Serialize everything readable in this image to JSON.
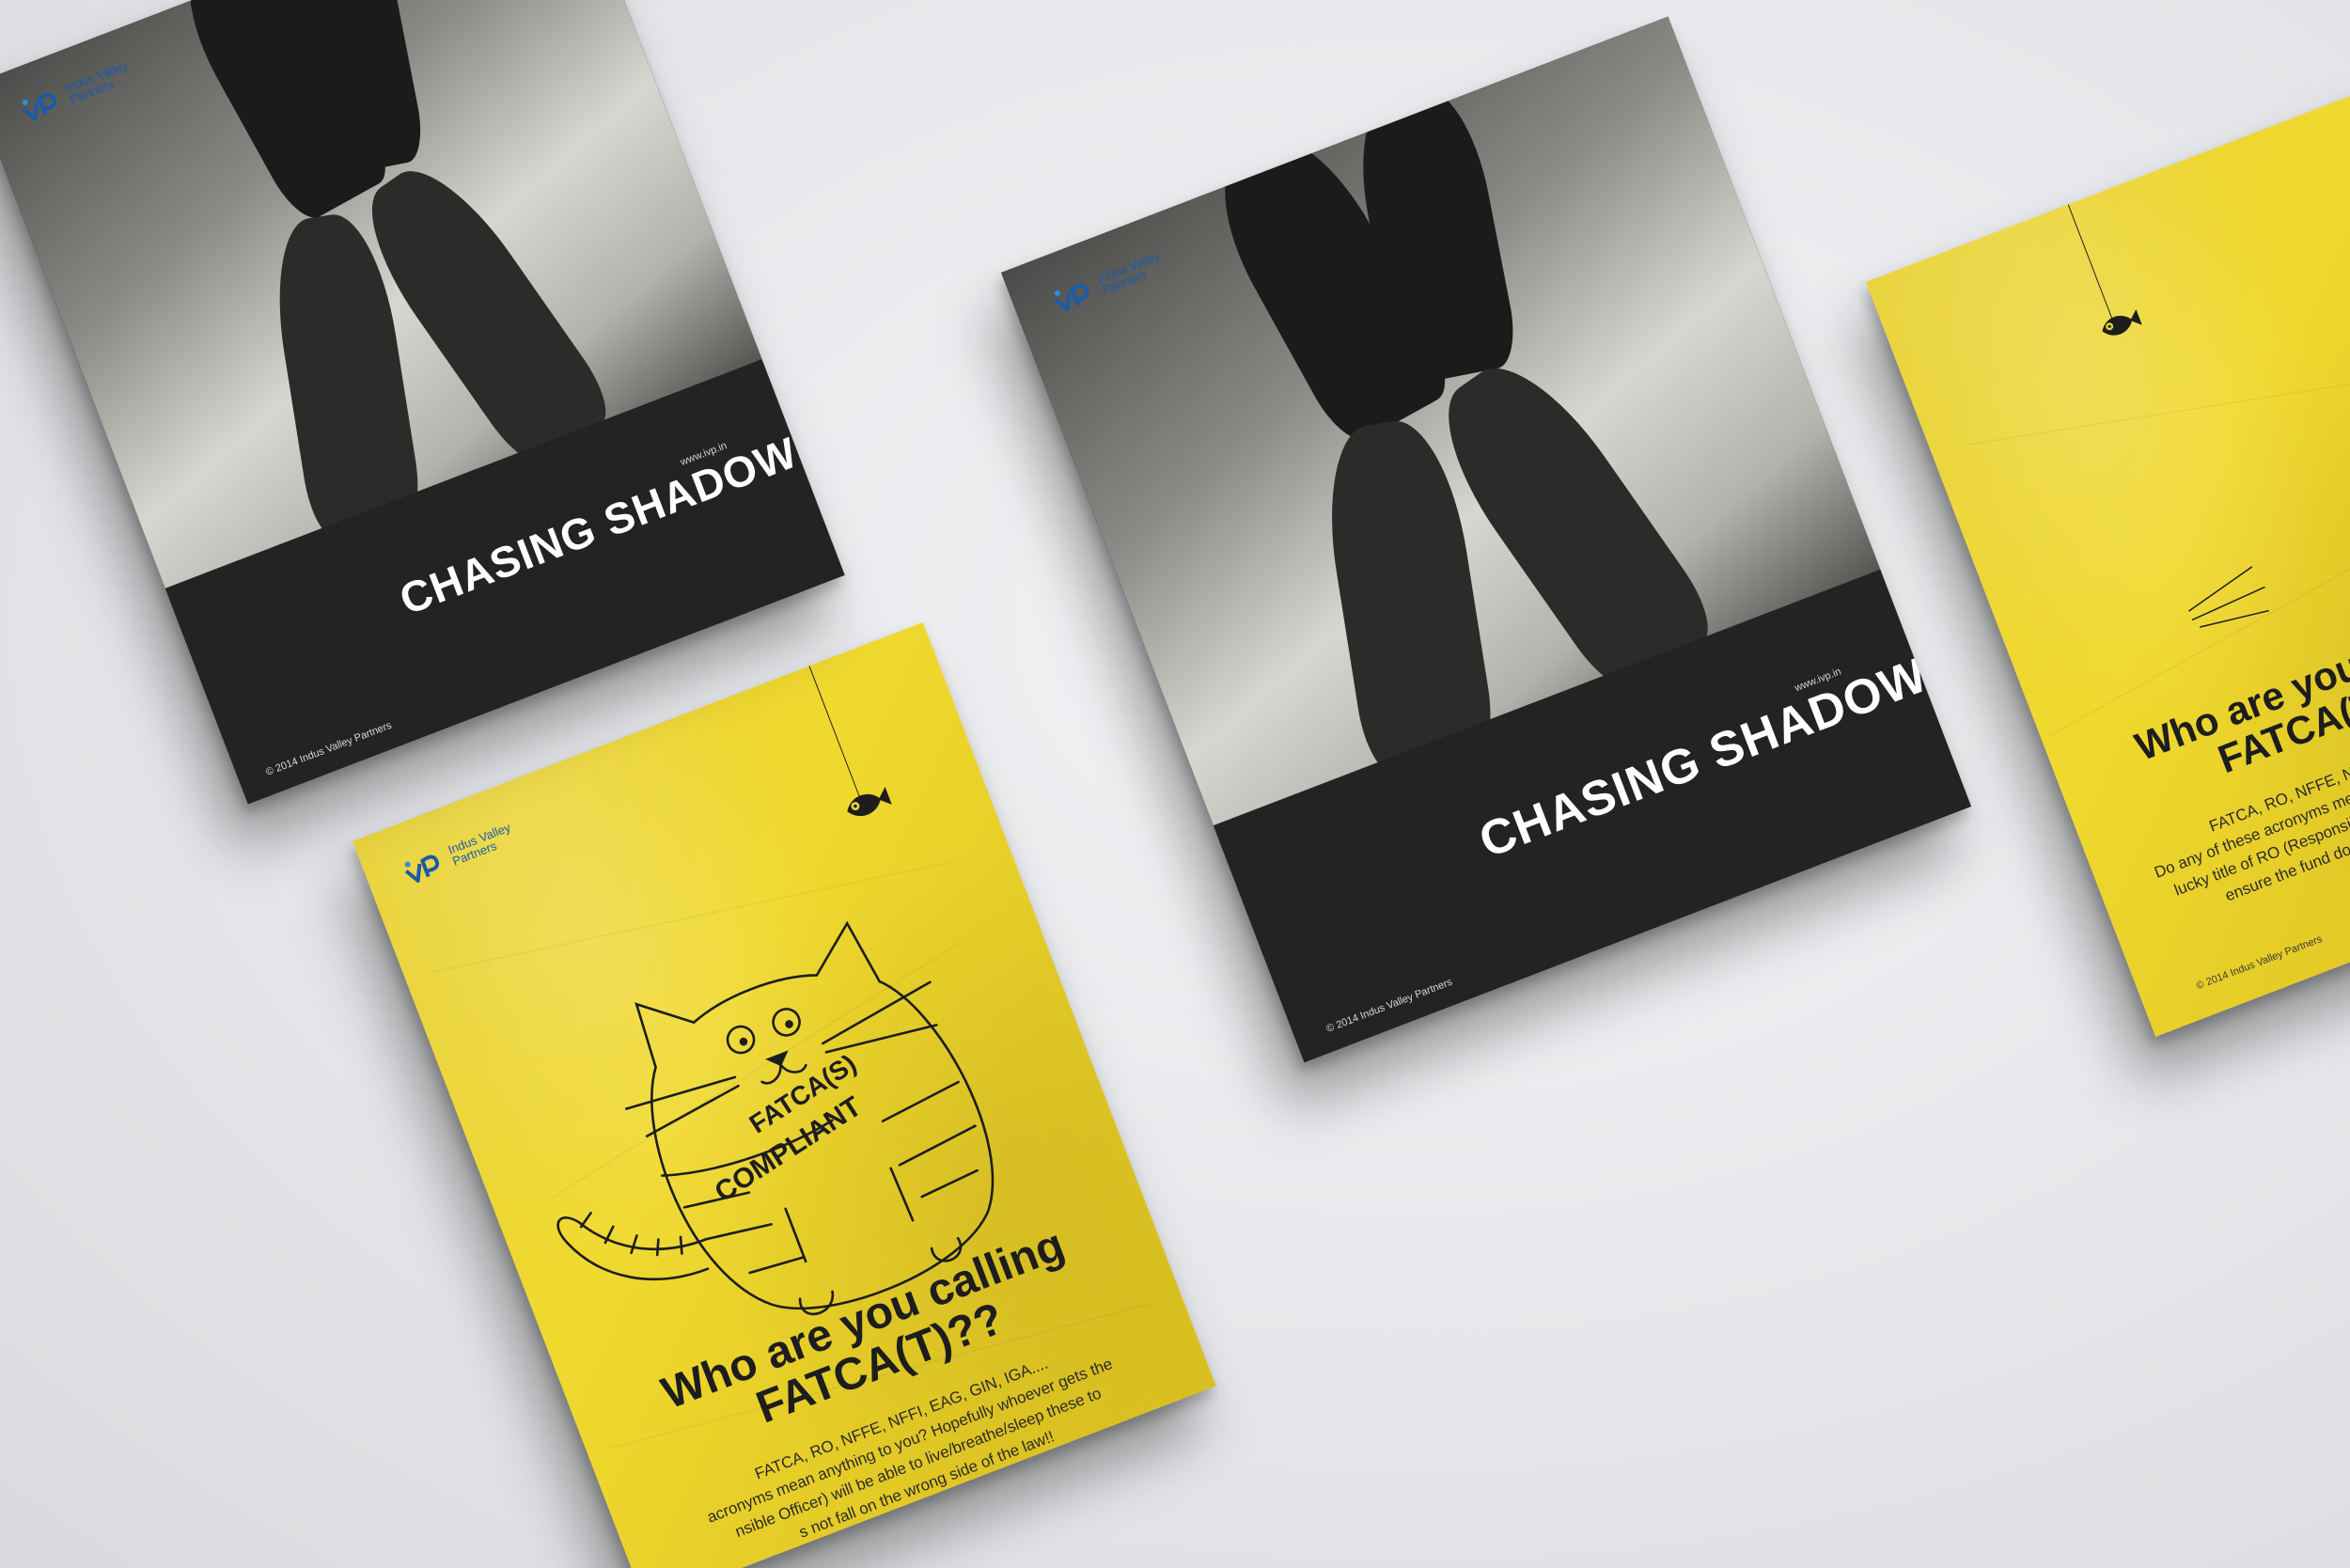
{
  "brand": {
    "logo_text_line1": "Indus Valley",
    "logo_text_line2": "Partners",
    "website": "www.ivp.in",
    "copyright": "© 2014 Indus Valley Partners",
    "logo_color": "#1a5aa8"
  },
  "dark_cover": {
    "title": "CHASING SHADOWS"
  },
  "yellow_cover": {
    "badge_line1": "FATCA(S)",
    "badge_line2": "COMPLIANT",
    "headline_line1": "Who are you calling",
    "headline_line2": "FATCA(T)??",
    "body_front": [
      "FATCA, RO, NFFE, NFFI, EAG, GIN, IGA....",
      "acronyms mean anything to you? Hopefully whoever gets the",
      "nsible Officer) will be able to live/breathe/sleep these to",
      "s not fall on the wrong side of the law!!"
    ],
    "body_back": [
      "FATCA, RO, NFFE, NFFI, EAG, GIN, IGA....",
      "Do any of these acronyms mean anything to you? Hopefully wh",
      "lucky title of RO (Responsible Officer) will be able to live/bre",
      "ensure the fund does not fall on the wrong side"
    ],
    "colors": {
      "yellow": "#e8d23a",
      "ink": "#1d1d1d"
    }
  }
}
